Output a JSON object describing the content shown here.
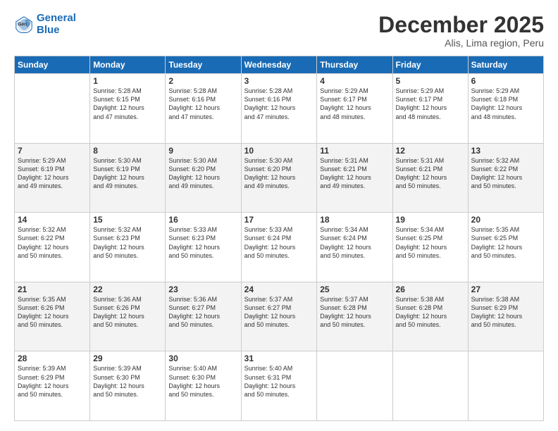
{
  "header": {
    "logo_line1": "General",
    "logo_line2": "Blue",
    "month": "December 2025",
    "location": "Alis, Lima region, Peru"
  },
  "days_of_week": [
    "Sunday",
    "Monday",
    "Tuesday",
    "Wednesday",
    "Thursday",
    "Friday",
    "Saturday"
  ],
  "weeks": [
    [
      {
        "day": "",
        "info": ""
      },
      {
        "day": "1",
        "info": "Sunrise: 5:28 AM\nSunset: 6:15 PM\nDaylight: 12 hours\nand 47 minutes."
      },
      {
        "day": "2",
        "info": "Sunrise: 5:28 AM\nSunset: 6:16 PM\nDaylight: 12 hours\nand 47 minutes."
      },
      {
        "day": "3",
        "info": "Sunrise: 5:28 AM\nSunset: 6:16 PM\nDaylight: 12 hours\nand 47 minutes."
      },
      {
        "day": "4",
        "info": "Sunrise: 5:29 AM\nSunset: 6:17 PM\nDaylight: 12 hours\nand 48 minutes."
      },
      {
        "day": "5",
        "info": "Sunrise: 5:29 AM\nSunset: 6:17 PM\nDaylight: 12 hours\nand 48 minutes."
      },
      {
        "day": "6",
        "info": "Sunrise: 5:29 AM\nSunset: 6:18 PM\nDaylight: 12 hours\nand 48 minutes."
      }
    ],
    [
      {
        "day": "7",
        "info": "Sunrise: 5:29 AM\nSunset: 6:19 PM\nDaylight: 12 hours\nand 49 minutes."
      },
      {
        "day": "8",
        "info": "Sunrise: 5:30 AM\nSunset: 6:19 PM\nDaylight: 12 hours\nand 49 minutes."
      },
      {
        "day": "9",
        "info": "Sunrise: 5:30 AM\nSunset: 6:20 PM\nDaylight: 12 hours\nand 49 minutes."
      },
      {
        "day": "10",
        "info": "Sunrise: 5:30 AM\nSunset: 6:20 PM\nDaylight: 12 hours\nand 49 minutes."
      },
      {
        "day": "11",
        "info": "Sunrise: 5:31 AM\nSunset: 6:21 PM\nDaylight: 12 hours\nand 49 minutes."
      },
      {
        "day": "12",
        "info": "Sunrise: 5:31 AM\nSunset: 6:21 PM\nDaylight: 12 hours\nand 50 minutes."
      },
      {
        "day": "13",
        "info": "Sunrise: 5:32 AM\nSunset: 6:22 PM\nDaylight: 12 hours\nand 50 minutes."
      }
    ],
    [
      {
        "day": "14",
        "info": "Sunrise: 5:32 AM\nSunset: 6:22 PM\nDaylight: 12 hours\nand 50 minutes."
      },
      {
        "day": "15",
        "info": "Sunrise: 5:32 AM\nSunset: 6:23 PM\nDaylight: 12 hours\nand 50 minutes."
      },
      {
        "day": "16",
        "info": "Sunrise: 5:33 AM\nSunset: 6:23 PM\nDaylight: 12 hours\nand 50 minutes."
      },
      {
        "day": "17",
        "info": "Sunrise: 5:33 AM\nSunset: 6:24 PM\nDaylight: 12 hours\nand 50 minutes."
      },
      {
        "day": "18",
        "info": "Sunrise: 5:34 AM\nSunset: 6:24 PM\nDaylight: 12 hours\nand 50 minutes."
      },
      {
        "day": "19",
        "info": "Sunrise: 5:34 AM\nSunset: 6:25 PM\nDaylight: 12 hours\nand 50 minutes."
      },
      {
        "day": "20",
        "info": "Sunrise: 5:35 AM\nSunset: 6:25 PM\nDaylight: 12 hours\nand 50 minutes."
      }
    ],
    [
      {
        "day": "21",
        "info": "Sunrise: 5:35 AM\nSunset: 6:26 PM\nDaylight: 12 hours\nand 50 minutes."
      },
      {
        "day": "22",
        "info": "Sunrise: 5:36 AM\nSunset: 6:26 PM\nDaylight: 12 hours\nand 50 minutes."
      },
      {
        "day": "23",
        "info": "Sunrise: 5:36 AM\nSunset: 6:27 PM\nDaylight: 12 hours\nand 50 minutes."
      },
      {
        "day": "24",
        "info": "Sunrise: 5:37 AM\nSunset: 6:27 PM\nDaylight: 12 hours\nand 50 minutes."
      },
      {
        "day": "25",
        "info": "Sunrise: 5:37 AM\nSunset: 6:28 PM\nDaylight: 12 hours\nand 50 minutes."
      },
      {
        "day": "26",
        "info": "Sunrise: 5:38 AM\nSunset: 6:28 PM\nDaylight: 12 hours\nand 50 minutes."
      },
      {
        "day": "27",
        "info": "Sunrise: 5:38 AM\nSunset: 6:29 PM\nDaylight: 12 hours\nand 50 minutes."
      }
    ],
    [
      {
        "day": "28",
        "info": "Sunrise: 5:39 AM\nSunset: 6:29 PM\nDaylight: 12 hours\nand 50 minutes."
      },
      {
        "day": "29",
        "info": "Sunrise: 5:39 AM\nSunset: 6:30 PM\nDaylight: 12 hours\nand 50 minutes."
      },
      {
        "day": "30",
        "info": "Sunrise: 5:40 AM\nSunset: 6:30 PM\nDaylight: 12 hours\nand 50 minutes."
      },
      {
        "day": "31",
        "info": "Sunrise: 5:40 AM\nSunset: 6:31 PM\nDaylight: 12 hours\nand 50 minutes."
      },
      {
        "day": "",
        "info": ""
      },
      {
        "day": "",
        "info": ""
      },
      {
        "day": "",
        "info": ""
      }
    ]
  ]
}
